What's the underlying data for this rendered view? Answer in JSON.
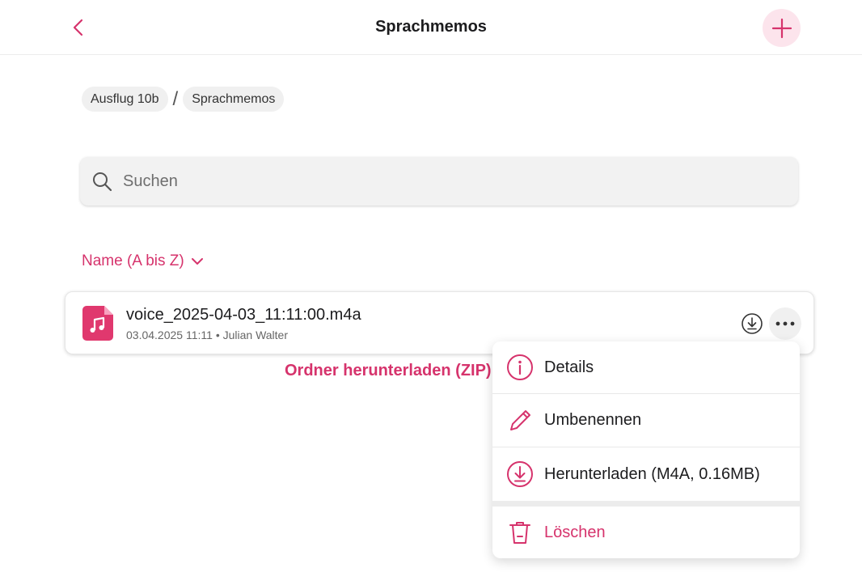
{
  "header": {
    "title": "Sprachmemos",
    "back_icon": "chevron-left-icon",
    "add_icon": "plus-icon"
  },
  "breadcrumb": [
    "Ausflug 10b",
    "Sprachmemos"
  ],
  "breadcrumb_separator": "/",
  "search": {
    "placeholder": "Suchen",
    "value": "",
    "icon": "search-icon"
  },
  "sort": {
    "label": "Name (A bis Z)",
    "icon": "chevron-down-icon"
  },
  "files": [
    {
      "name": "voice_2025-04-03_11:11:00.m4a",
      "date": "03.04.2025 11:11",
      "separator": "•",
      "owner": "Julian Walter",
      "icon": "audio-file-icon"
    }
  ],
  "folder_download_label": "Ordner herunterladen (ZIP)",
  "context_menu": {
    "items": [
      {
        "label": "Details",
        "icon": "info-icon"
      },
      {
        "label": "Umbenennen",
        "icon": "pencil-icon"
      },
      {
        "label": "Herunterladen (M4A, 0.16MB)",
        "icon": "download-icon"
      },
      {
        "label": "Löschen",
        "icon": "trash-icon"
      }
    ]
  },
  "colors": {
    "accent": "#d6336c",
    "accent_light": "#fce4ec"
  }
}
